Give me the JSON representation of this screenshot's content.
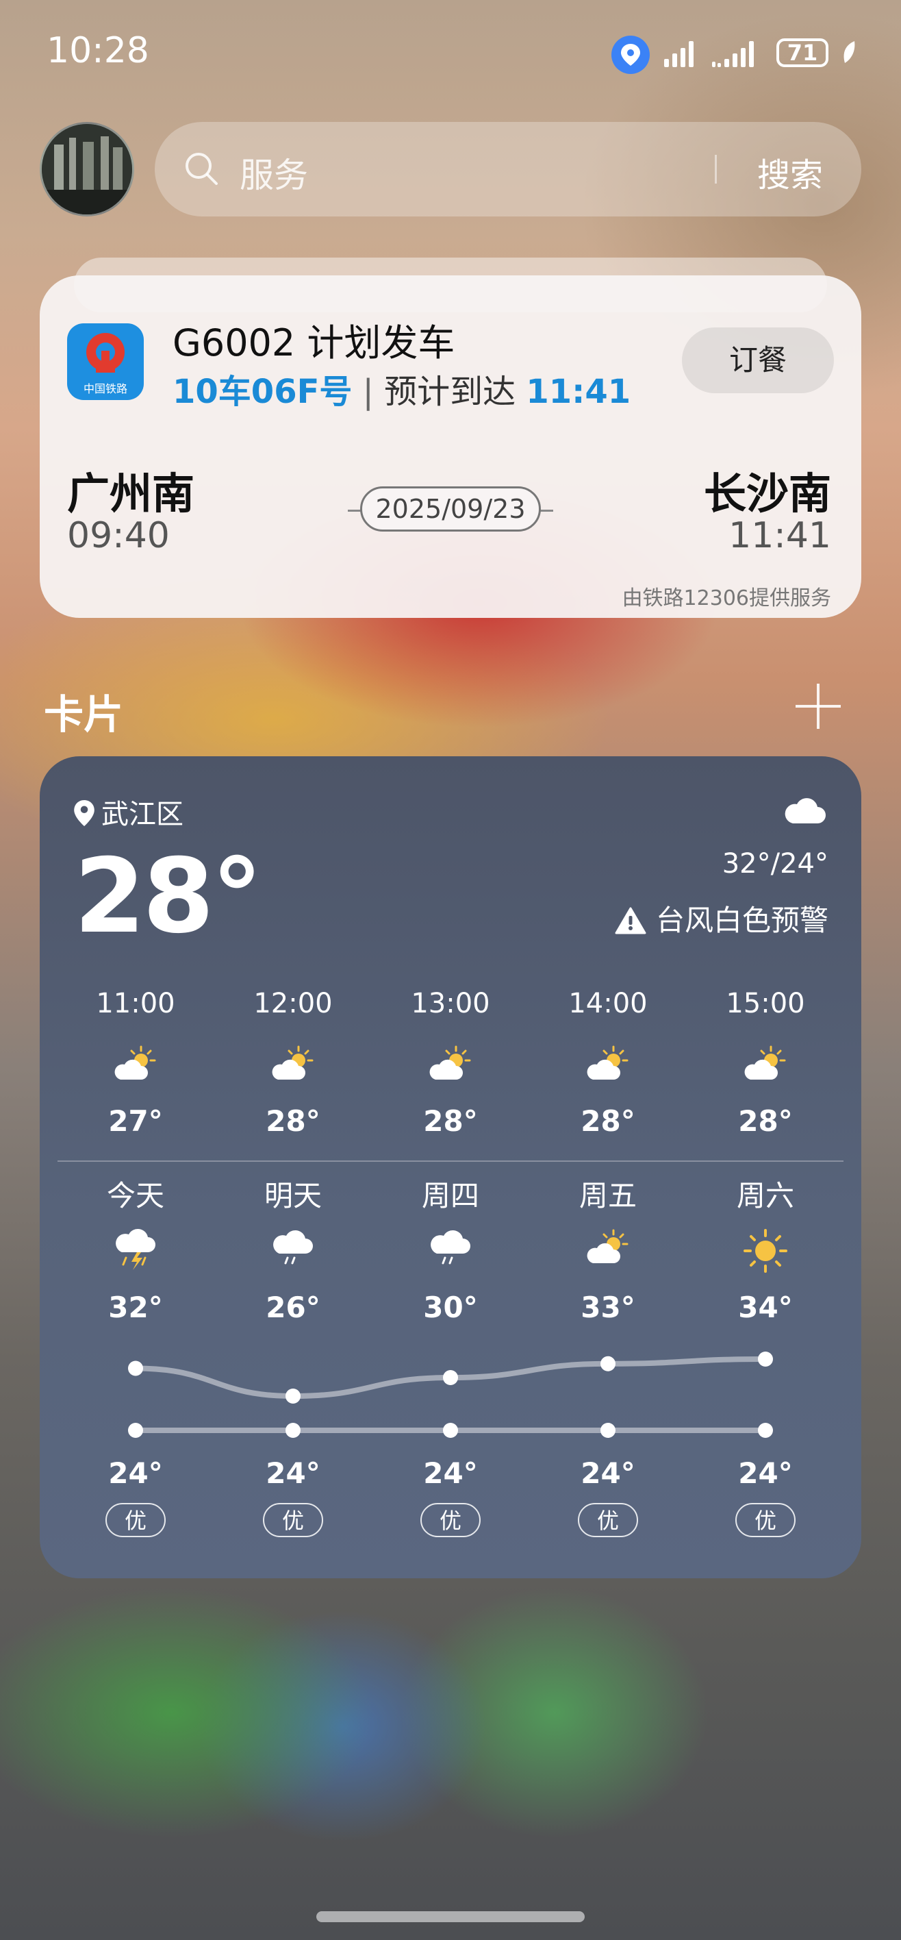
{
  "status_bar": {
    "time": "10:28",
    "battery": "71"
  },
  "search": {
    "placeholder": "服务",
    "button": "搜索"
  },
  "train": {
    "title": "G6002 计划发车",
    "seat": "10车06F号",
    "sep": " | ",
    "arrive_prefix": "预计到达 ",
    "arrive_time": "11:41",
    "order_button": "订餐",
    "logo_text": "中国铁路",
    "from_station": "广州南",
    "from_time": "09:40",
    "to_station": "长沙南",
    "to_time": "11:41",
    "date": "2025/09/23",
    "provider": "由铁路12306提供服务"
  },
  "section": {
    "title": "卡片"
  },
  "weather": {
    "location": "武江区",
    "current_temp": "28°",
    "range": "32°/24°",
    "alert": "台风白色预警",
    "hourly": [
      {
        "time": "11:00",
        "temp": "27°",
        "icon": "partly-cloudy-sun-icon"
      },
      {
        "time": "12:00",
        "temp": "28°",
        "icon": "partly-cloudy-sun-icon"
      },
      {
        "time": "13:00",
        "temp": "28°",
        "icon": "partly-cloudy-sun-icon"
      },
      {
        "time": "14:00",
        "temp": "28°",
        "icon": "partly-cloudy-sun-icon"
      },
      {
        "time": "15:00",
        "temp": "28°",
        "icon": "partly-cloudy-sun-icon"
      }
    ],
    "daily": [
      {
        "label": "今天",
        "high": "32°",
        "low": "24°",
        "aqi": "优",
        "icon": "thunderstorm-icon"
      },
      {
        "label": "明天",
        "high": "26°",
        "low": "24°",
        "aqi": "优",
        "icon": "rain-cloud-icon"
      },
      {
        "label": "周四",
        "high": "30°",
        "low": "24°",
        "aqi": "优",
        "icon": "rain-cloud-icon"
      },
      {
        "label": "周五",
        "high": "33°",
        "low": "24°",
        "aqi": "优",
        "icon": "partly-cloudy-sun-icon"
      },
      {
        "label": "周六",
        "high": "34°",
        "low": "24°",
        "aqi": "优",
        "icon": "sun-icon"
      }
    ]
  },
  "colors": {
    "accent_blue": "#1a8ad6",
    "weather_bg": "#57637a",
    "sun": "#f6c343"
  }
}
